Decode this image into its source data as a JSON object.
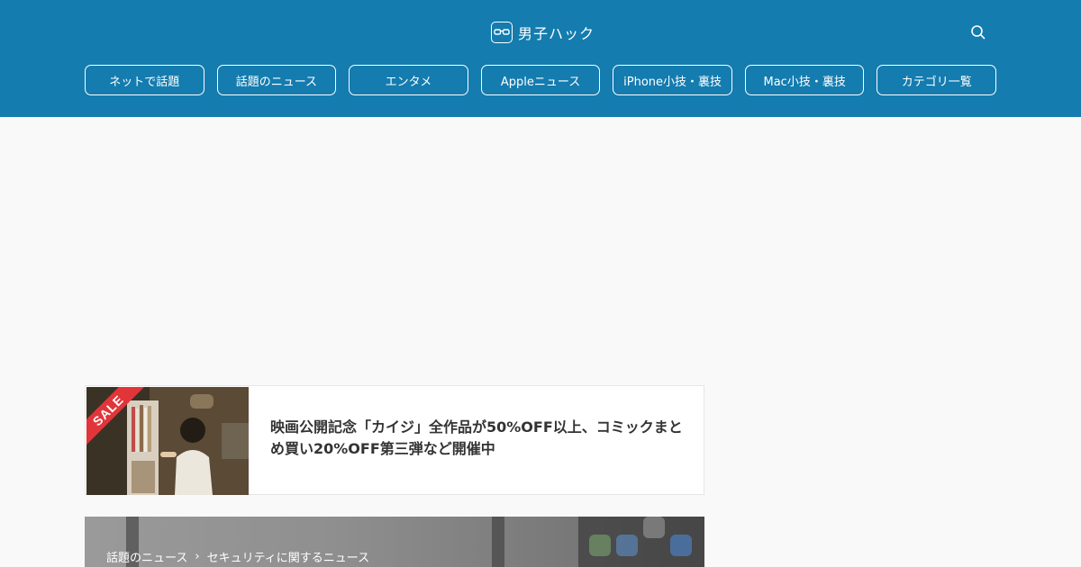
{
  "header": {
    "site_title": "男子ハック",
    "logo_icon": "glasses-icon",
    "search_icon": "search-icon",
    "bg_color": "#147caf"
  },
  "nav": {
    "items": [
      {
        "label": "ネットで話題"
      },
      {
        "label": "話題のニュース"
      },
      {
        "label": "エンタメ"
      },
      {
        "label": "Appleニュース"
      },
      {
        "label": "iPhone小技・裏技"
      },
      {
        "label": "Mac小技・裏技"
      },
      {
        "label": "カテゴリ一覧"
      }
    ]
  },
  "article_card": {
    "badge": "SALE",
    "badge_color": "#e2353a",
    "title": "映画公開記念「カイジ」全作品が50%OFF以上、コミックまとめ買い20%OFF第三弾など開催中"
  },
  "featured": {
    "breadcrumb": [
      "話題のニュース",
      "セキュリティに関するニュース"
    ],
    "separator": "›"
  }
}
